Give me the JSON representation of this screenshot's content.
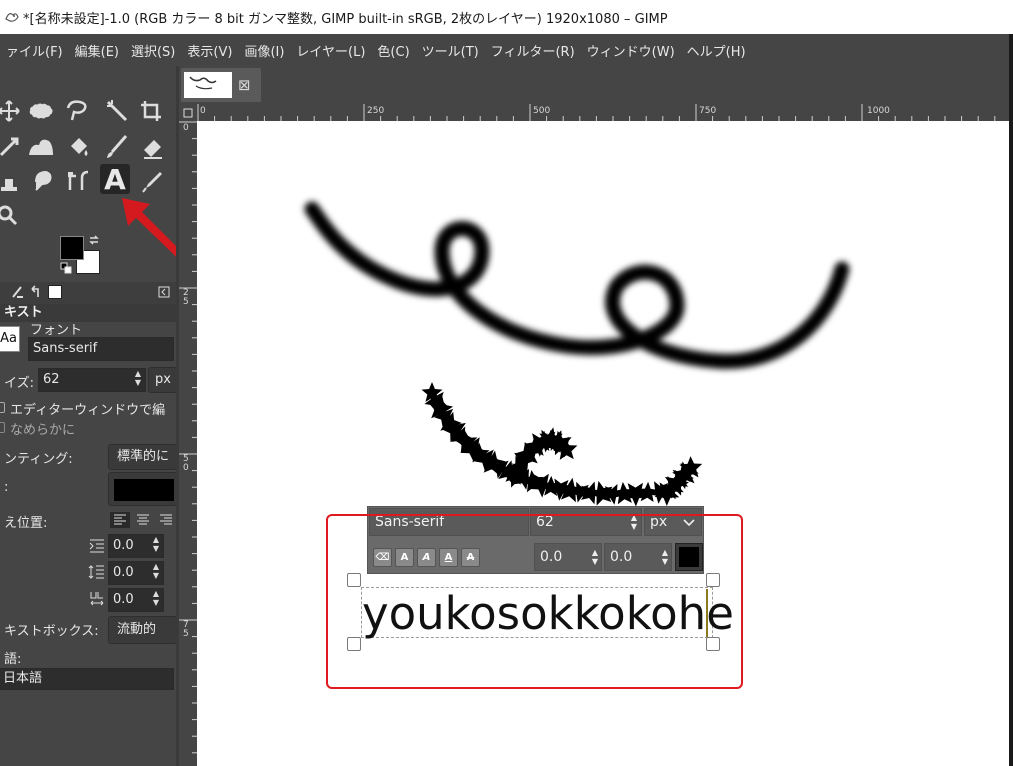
{
  "window": {
    "title": "*[名称未設定]-1.0 (RGB カラー 8 bit ガンマ整数, GIMP built-in sRGB, 2枚のレイヤー) 1920x1080 – GIMP"
  },
  "menu": [
    {
      "id": "file",
      "label": "ァイル(F)"
    },
    {
      "id": "edit",
      "label": "編集(E)"
    },
    {
      "id": "select",
      "label": "選択(S)"
    },
    {
      "id": "view",
      "label": "表示(V)"
    },
    {
      "id": "image",
      "label": "画像(I)"
    },
    {
      "id": "layer",
      "label": "レイヤー(L)"
    },
    {
      "id": "color",
      "label": "色(C)"
    },
    {
      "id": "tools",
      "label": "ツール(T)"
    },
    {
      "id": "filters",
      "label": "フィルター(R)"
    },
    {
      "id": "windows",
      "label": "ウィンドウ(W)"
    },
    {
      "id": "help",
      "label": "ヘルプ(H)"
    }
  ],
  "tool_icons": [
    "move-tool-icon",
    "ellipse-select-icon",
    "free-select-icon",
    "fuzzy-select-icon",
    "crop-icon",
    "transform-icon",
    "warp-icon",
    "bucket-fill-icon",
    "paintbrush-icon",
    "eraser-icon",
    "clone-icon",
    "smudge-icon",
    "paths-icon",
    "text-tool-icon",
    "color-picker-icon",
    "zoom-icon"
  ],
  "text_tool_glyph": "A",
  "tool_options": {
    "title": "キスト",
    "font_label": "フォント",
    "font_preview": "Aa",
    "font_value": "Sans-serif",
    "size_label": "イズ:",
    "size_value": "62",
    "size_unit": "px",
    "use_editor_label": "エディターウィンドウで編",
    "antialias_label": "なめらかに",
    "hinting_label": "ンティング:",
    "hinting_value": "標準的に",
    "color_label": ":",
    "justify_label": "え位置:",
    "indent_value": "0.0",
    "line_spacing_value": "0.0",
    "letter_spacing_value": "0.0",
    "box_label": "キストボックス:",
    "box_value": "流動的",
    "language_label": "語:",
    "language_value": "日本語"
  },
  "rulers": {
    "top": [
      "0",
      "250",
      "500",
      "750",
      "1000"
    ],
    "left": [
      "0",
      "2 5",
      "5 0",
      "7 5"
    ]
  },
  "text_overlay": {
    "font": "Sans-serif",
    "size": "62",
    "unit": "px",
    "baseline": "0.0",
    "kerning": "0.0",
    "style_buttons": [
      "clear-style",
      "bold",
      "italic",
      "underline",
      "strikethrough"
    ]
  },
  "canvas_text": "youkosokkokohe",
  "colors": {
    "panel": "#454545",
    "annotation": "#e0191f",
    "foreground": "#000000",
    "background": "#ffffff"
  }
}
